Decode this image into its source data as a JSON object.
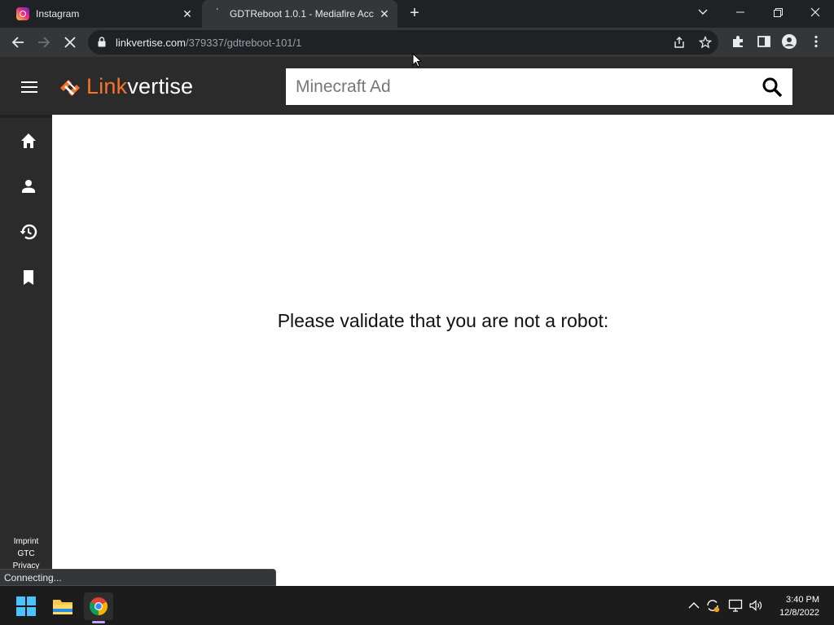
{
  "browser": {
    "tabs": [
      {
        "title": "Instagram",
        "icon": "instagram-icon",
        "active": false
      },
      {
        "title": "GDTReboot 1.0.1 - Mediafire Acc",
        "icon": "loading-icon",
        "active": true
      }
    ],
    "url_host": "linkvertise.com",
    "url_path": "/379337/gdtreboot-101/1"
  },
  "site": {
    "logo_link": "Link",
    "logo_vertise": "vertise",
    "search_placeholder": "Minecraft Ad",
    "brand_color": "#f6742a"
  },
  "sidebar": {
    "items": [
      {
        "name": "home",
        "icon": "home-icon"
      },
      {
        "name": "profile",
        "icon": "person-icon"
      },
      {
        "name": "history",
        "icon": "history-icon"
      },
      {
        "name": "bookmarks",
        "icon": "bookmark-icon"
      }
    ],
    "footer_links": [
      "Imprint",
      "GTC",
      "Privacy"
    ]
  },
  "main": {
    "message": "Please validate that you are not a robot:"
  },
  "status_bar": {
    "text": "Connecting..."
  },
  "taskbar": {
    "time": "3:40 PM",
    "date": "12/8/2022"
  }
}
